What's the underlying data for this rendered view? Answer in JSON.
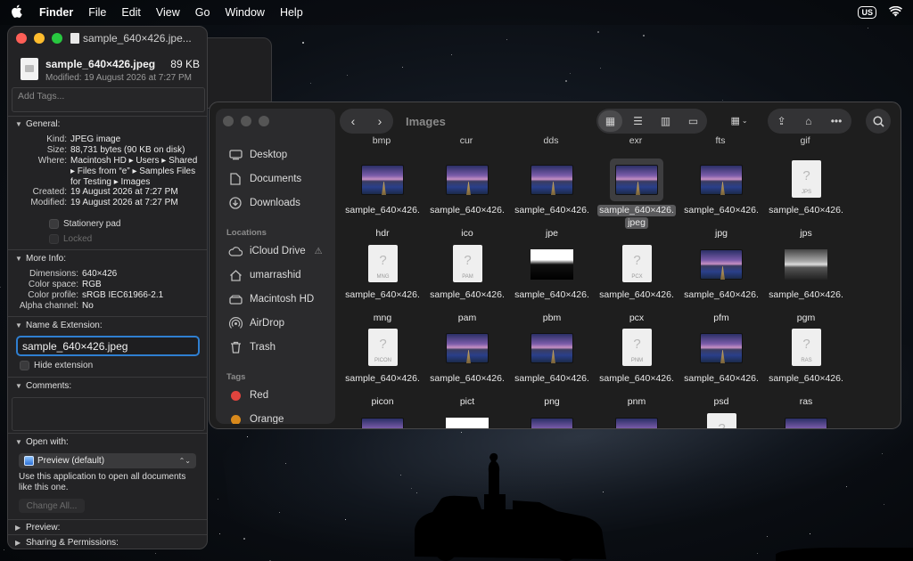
{
  "menubar": {
    "app": "Finder",
    "items": [
      "File",
      "Edit",
      "View",
      "Go",
      "Window",
      "Help"
    ],
    "input_source": "US"
  },
  "info_panel": {
    "window_title": "sample_640×426.jpe...",
    "file_name": "sample_640×426.jpeg",
    "file_size": "89 KB",
    "modified_line": "Modified: 19 August 2026 at 7:27 PM",
    "tags_placeholder": "Add Tags...",
    "general": {
      "label": "General:",
      "kind_k": "Kind:",
      "kind_v": "JPEG image",
      "size_k": "Size:",
      "size_v": "88,731 bytes (90 KB on disk)",
      "where_k": "Where:",
      "where_v": "Macintosh HD ▸ Users ▸ Shared ▸ Files from “e” ▸ Samples Files for Testing ▸ Images",
      "created_k": "Created:",
      "created_v": "19 August 2026 at 7:27 PM",
      "modified_k": "Modified:",
      "modified_v": "19 August 2026 at 7:27 PM",
      "stationery": "Stationery pad",
      "locked": "Locked"
    },
    "more_info": {
      "label": "More Info:",
      "dimensions_k": "Dimensions:",
      "dimensions_v": "640×426",
      "colorspace_k": "Color space:",
      "colorspace_v": "RGB",
      "profile_k": "Color profile:",
      "profile_v": "sRGB IEC61966-2.1",
      "alpha_k": "Alpha channel:",
      "alpha_v": "No"
    },
    "name_ext": {
      "label": "Name & Extension:",
      "value": "sample_640×426.jpeg",
      "hide_ext": "Hide extension"
    },
    "comments_label": "Comments:",
    "open_with": {
      "label": "Open with:",
      "app": "Preview (default)",
      "note": "Use this application to open all documents like this one.",
      "change_all": "Change All..."
    },
    "preview_label": "Preview:",
    "sharing_label": "Sharing & Permissions:"
  },
  "finder": {
    "title": "Images",
    "sidebar": {
      "favorites": [
        {
          "label": "Desktop",
          "icon": "desktop-icon"
        },
        {
          "label": "Documents",
          "icon": "document-icon"
        },
        {
          "label": "Downloads",
          "icon": "download-icon"
        }
      ],
      "locations_head": "Locations",
      "locations": [
        {
          "label": "iCloud Drive",
          "icon": "cloud-icon"
        },
        {
          "label": "umarrashid",
          "icon": "home-icon"
        },
        {
          "label": "Macintosh HD",
          "icon": "disk-icon"
        },
        {
          "label": "AirDrop",
          "icon": "airdrop-icon"
        },
        {
          "label": "Trash",
          "icon": "trash-icon"
        }
      ],
      "tags_head": "Tags",
      "tags": [
        {
          "label": "Red",
          "color": "#e0443e"
        },
        {
          "label": "Orange",
          "color": "#d8891c"
        }
      ]
    },
    "top_labels": [
      "bmp",
      "cur",
      "dds",
      "exr",
      "fts",
      "gif"
    ],
    "rows": [
      [
        {
          "l1": "sample_640×426.",
          "l2": "hdr",
          "thumb": "photo",
          "badge": ""
        },
        {
          "l1": "sample_640×426.",
          "l2": "ico",
          "thumb": "photo",
          "badge": ""
        },
        {
          "l1": "sample_640×426.",
          "l2": "jpe",
          "thumb": "photo",
          "badge": ""
        },
        {
          "l1": "sample_640×426.",
          "l2": "jpeg",
          "thumb": "photo",
          "badge": "",
          "selected": true
        },
        {
          "l1": "sample_640×426.",
          "l2": "jpg",
          "thumb": "photo",
          "badge": ""
        },
        {
          "l1": "sample_640×426.",
          "l2": "jps",
          "thumb": "doc",
          "badge": "JPS"
        }
      ],
      [
        {
          "l1": "sample_640×426.",
          "l2": "mng",
          "thumb": "doc",
          "badge": "MNG"
        },
        {
          "l1": "sample_640×426.",
          "l2": "pam",
          "thumb": "doc",
          "badge": "PAM"
        },
        {
          "l1": "sample_640×426.",
          "l2": "pbm",
          "thumb": "bw2",
          "badge": ""
        },
        {
          "l1": "sample_640×426.",
          "l2": "pcx",
          "thumb": "doc",
          "badge": "PCX"
        },
        {
          "l1": "sample_640×426.",
          "l2": "pfm",
          "thumb": "photo",
          "badge": ""
        },
        {
          "l1": "sample_640×426.",
          "l2": "pgm",
          "thumb": "bw",
          "badge": ""
        }
      ],
      [
        {
          "l1": "sample_640×426.",
          "l2": "picon",
          "thumb": "doc",
          "badge": "PICON"
        },
        {
          "l1": "sample_640×426.",
          "l2": "pict",
          "thumb": "photo",
          "badge": ""
        },
        {
          "l1": "sample_640×426.",
          "l2": "png",
          "thumb": "photo",
          "badge": ""
        },
        {
          "l1": "sample_640×426.",
          "l2": "pnm",
          "thumb": "doc",
          "badge": "PNM"
        },
        {
          "l1": "sample_640×426.",
          "l2": "psd",
          "thumb": "photo",
          "badge": ""
        },
        {
          "l1": "sample_640×426.",
          "l2": "ras",
          "thumb": "doc",
          "badge": "RAS"
        }
      ],
      [
        {
          "l1": "",
          "l2": "",
          "thumb": "photo",
          "badge": ""
        },
        {
          "l1": "",
          "l2": "",
          "thumb": "bw2",
          "badge": ""
        },
        {
          "l1": "",
          "l2": "",
          "thumb": "photo",
          "badge": ""
        },
        {
          "l1": "",
          "l2": "",
          "thumb": "photo",
          "badge": ""
        },
        {
          "l1": "",
          "l2": "",
          "thumb": "doc",
          "badge": ""
        },
        {
          "l1": "",
          "l2": "",
          "thumb": "photo",
          "badge": ""
        }
      ]
    ]
  }
}
